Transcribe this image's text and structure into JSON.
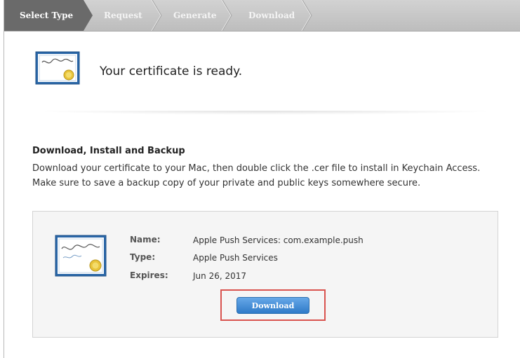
{
  "steps": [
    {
      "label": "Select Type",
      "state": "active"
    },
    {
      "label": "Request",
      "state": "inactive"
    },
    {
      "label": "Generate",
      "state": "inactive"
    },
    {
      "label": "Download",
      "state": "inactive"
    }
  ],
  "colors": {
    "active_step": "#6a6a6a",
    "inactive_step": "#b0b0b0",
    "button": "#2f7ac8",
    "highlight": "#d9534f"
  },
  "hero": {
    "icon": "certificate-icon",
    "title": "Your certificate is ready."
  },
  "section": {
    "heading": "Download, Install and Backup",
    "body": "Download your certificate to your Mac, then double click the .cer file to install in Keychain Access. Make sure to save a backup copy of your private and public keys somewhere secure."
  },
  "certificate": {
    "icon": "certificate-standard-icon",
    "name_label": "Name:",
    "name_value": "Apple Push Services: com.example.push",
    "type_label": "Type:",
    "type_value": "Apple Push Services",
    "expires_label": "Expires:",
    "expires_value": "Jun 26, 2017",
    "download_label": "Download"
  }
}
